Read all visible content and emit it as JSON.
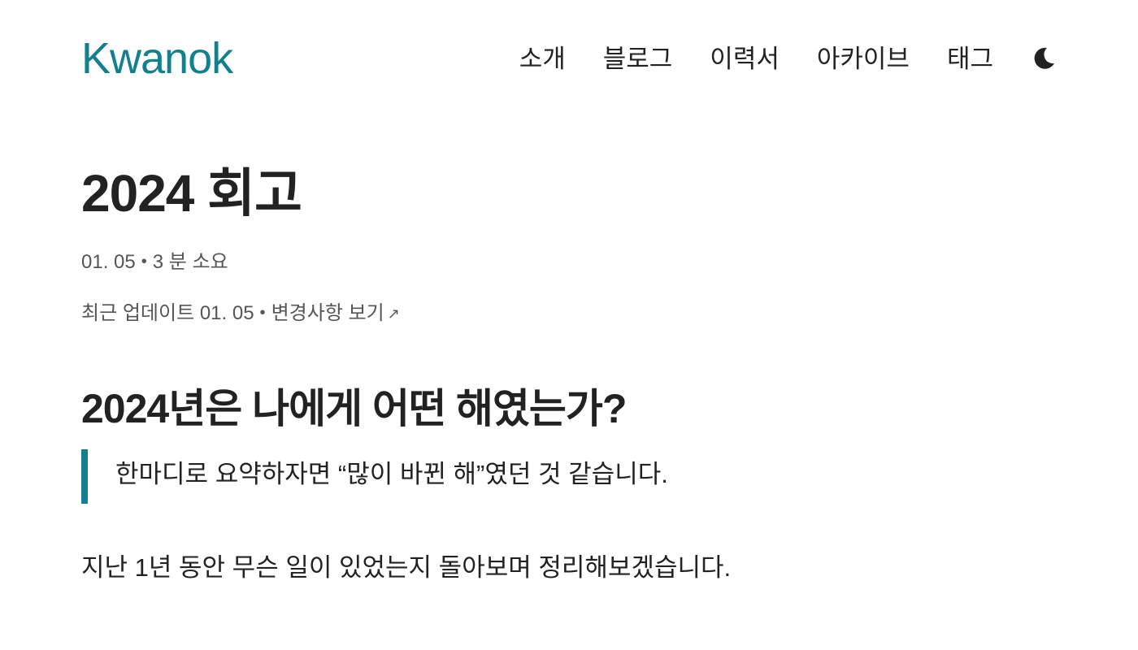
{
  "header": {
    "brand": "Kwanok",
    "brand_color": "#14808f",
    "nav": [
      {
        "label": "소개"
      },
      {
        "label": "블로그"
      },
      {
        "label": "이력서"
      },
      {
        "label": "아카이브"
      },
      {
        "label": "태그"
      }
    ],
    "theme_toggle_icon": "moon-icon"
  },
  "post": {
    "title": "2024 회고",
    "date": "01. 05",
    "separator": "•",
    "reading_time": "3 분 소요",
    "updated_label": "최근 업데이트 01. 05",
    "changes_link": "변경사항 보기",
    "changes_link_icon": "arrow-up-right-icon",
    "section_heading": "2024년은 나에게 어떤 해였는가?",
    "quote": "한마디로 요약하자면 “많이 바뀐 해”였던 것 같습니다.",
    "paragraph": "지난 1년 동안 무슨 일이 있었는지 돌아보며 정리해보겠습니다."
  }
}
